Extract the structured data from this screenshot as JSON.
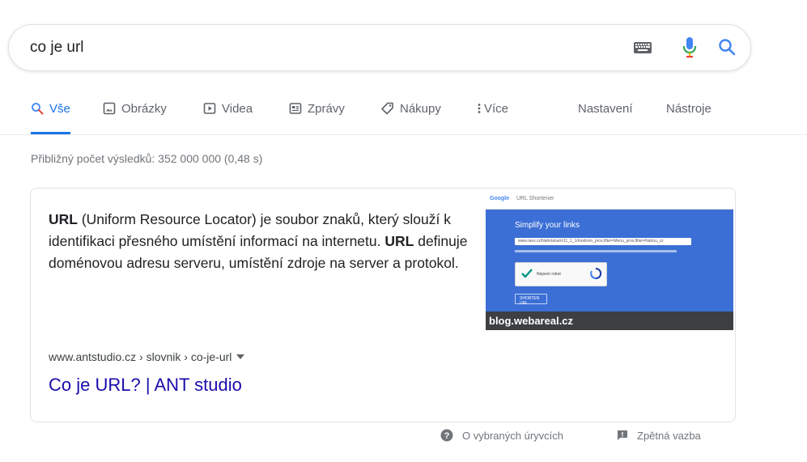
{
  "search": {
    "query": "co je url"
  },
  "tabs": [
    {
      "label": "Vše",
      "active": true
    },
    {
      "label": "Obrázky"
    },
    {
      "label": "Videa"
    },
    {
      "label": "Zprávy"
    },
    {
      "label": "Nákupy"
    },
    {
      "label": "Více"
    }
  ],
  "tools": {
    "settings": "Nastavení",
    "tools": "Nástroje"
  },
  "stats": "Přibližný počet výsledků: 352 000 000 (0,48 s)",
  "featured": {
    "snippet_parts": {
      "b1": "URL",
      "t1": " (Uniform Resource Locator) je soubor znaků, který slouží k identifikaci přesného umístění informací na internetu. ",
      "b2": "URL",
      "t2": " definuje doménovou adresu serveru, umístění zdroje na server a protokol."
    },
    "image": {
      "logo_text": "Google",
      "header_text": "URL Shortener",
      "headline": "Simplify your links",
      "url_text": "www.raov.cz/Nahrávka/n/11_1_1/modrom_pros,filter=Menu_pros,filter=Nahou_cz",
      "captcha_text": "Nejsem robot",
      "button_text": "SHORTEN URL",
      "caption": "blog.webareal.cz"
    },
    "cite": "www.antstudio.cz › slovnik › co-je-url",
    "title": "Co je URL? | ANT studio"
  },
  "footer": {
    "about": "O vybraných úryvcích",
    "feedback": "Zpětná vazba"
  },
  "colors": {
    "accent": "#1a73e8",
    "link": "#1a0dab",
    "mic_blue": "#4285f4",
    "mic_red": "#ea4335"
  }
}
